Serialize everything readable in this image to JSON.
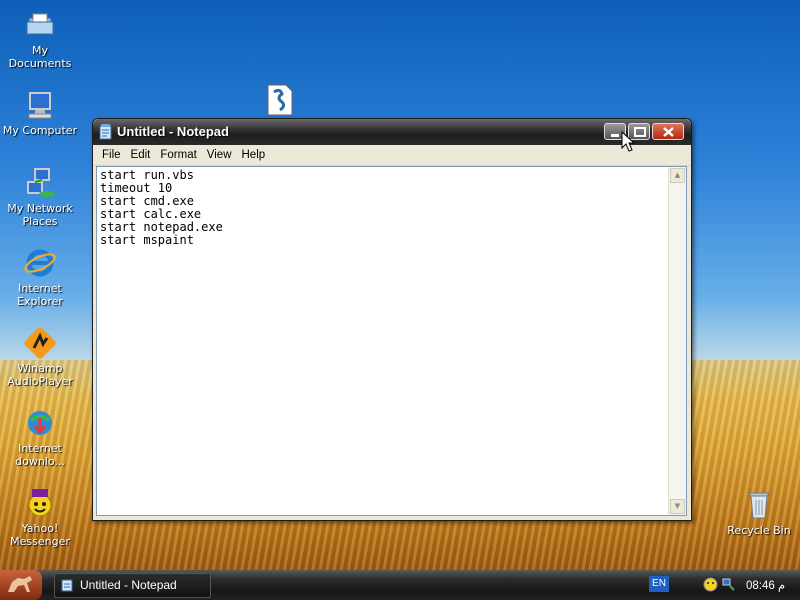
{
  "desktop": {
    "icons": [
      {
        "label": "My Documents"
      },
      {
        "label": "My Computer"
      },
      {
        "label": "My Network Places"
      },
      {
        "label": "Internet Explorer"
      },
      {
        "label": "Winamp AudioPlayer"
      },
      {
        "label": "Internet downlo..."
      },
      {
        "label": "Yahoo! Messenger"
      },
      {
        "label": "Recycle Bin"
      }
    ]
  },
  "window": {
    "title": "Untitled - Notepad",
    "menu": [
      "File",
      "Edit",
      "Format",
      "View",
      "Help"
    ],
    "content": "start run.vbs\ntimeout 10\nstart cmd.exe\nstart calc.exe\nstart notepad.exe\nstart mspaint"
  },
  "taskbar": {
    "task_label": "Untitled - Notepad",
    "language": "EN",
    "clock": "08:46 م"
  },
  "colors": {
    "titlebar": "#1e1e1e",
    "close_button": "#c0392b",
    "taskbar": "#1a1a1a"
  }
}
